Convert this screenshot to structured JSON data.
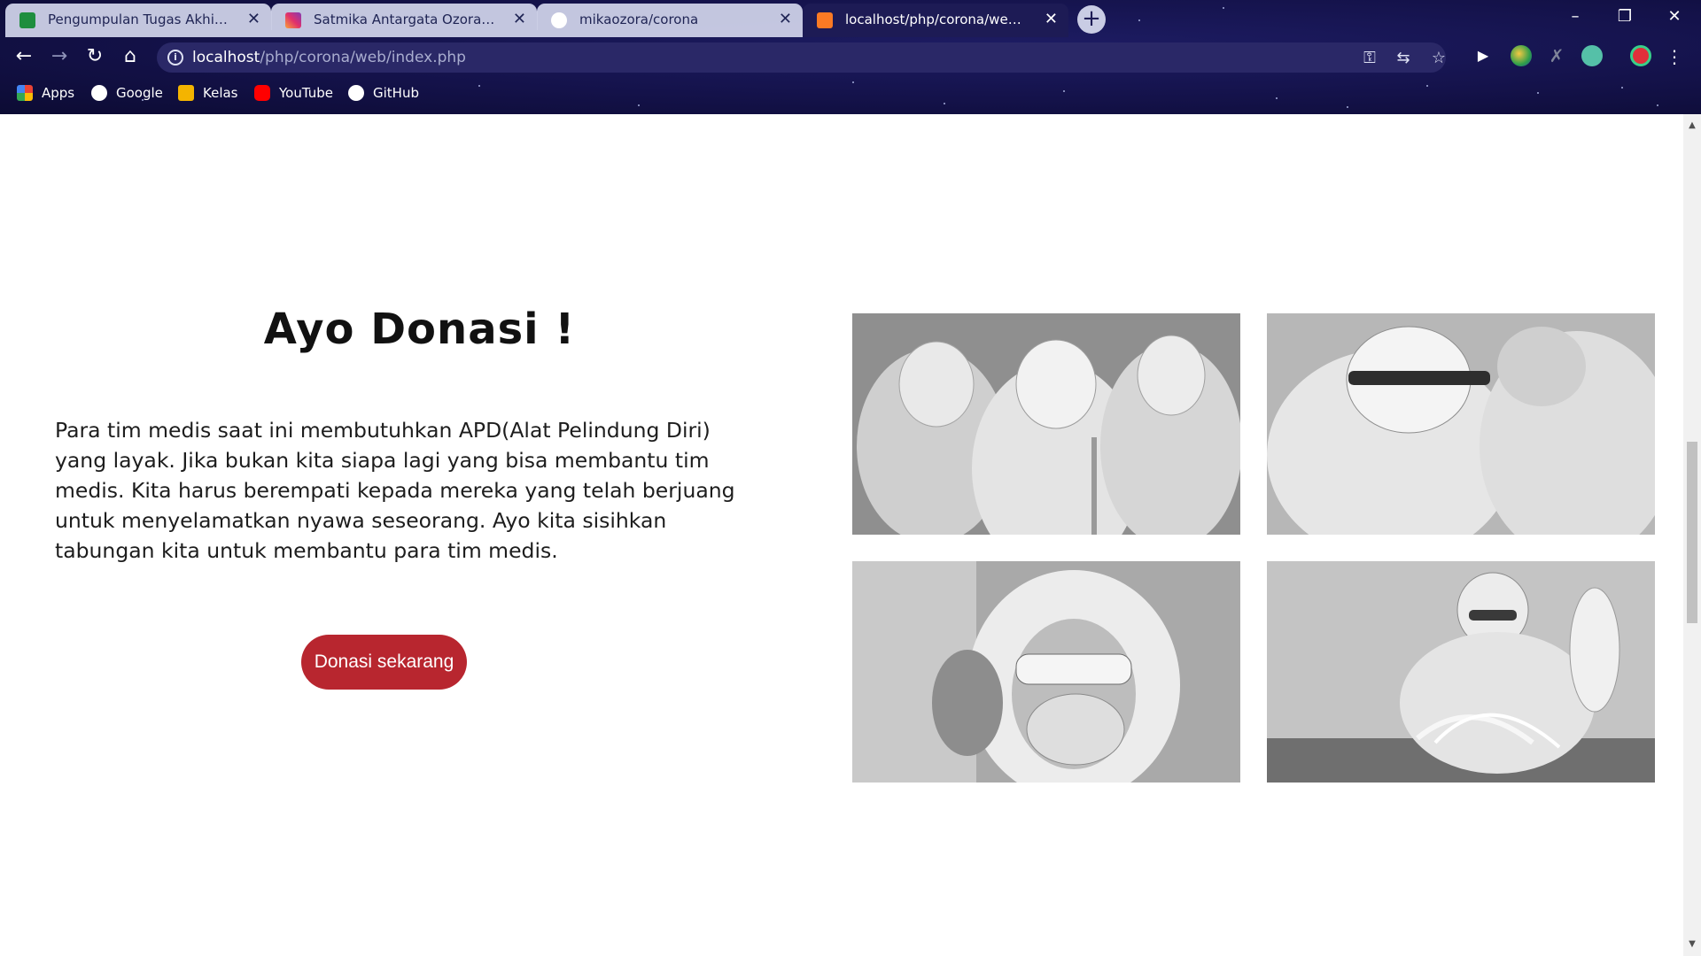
{
  "browser": {
    "tabs": [
      {
        "title": "Pengumpulan Tugas Akhir Web",
        "favicon_color": "#1e8e3e",
        "active": false
      },
      {
        "title": "Satmika Antargata Ozora (@antargata)",
        "favicon_color": "#e1306c",
        "active": false
      },
      {
        "title": "mikaozora/corona",
        "favicon_color": "#ffffff",
        "active": false
      },
      {
        "title": "localhost/php/corona/web/index.php",
        "favicon_color": "#fb7a24",
        "active": true
      }
    ],
    "new_tab_label": "+",
    "address": {
      "host": "localhost",
      "path": "/php/corona/web/index.php"
    },
    "bookmarks": [
      {
        "label": "Apps",
        "icon": "apps-grid-icon",
        "color": "#4285f4"
      },
      {
        "label": "Google",
        "icon": "google-icon",
        "color": "#ffffff"
      },
      {
        "label": "Kelas",
        "icon": "classroom-icon",
        "color": "#f4b400"
      },
      {
        "label": "YouTube",
        "icon": "youtube-icon",
        "color": "#ff0000"
      },
      {
        "label": "GitHub",
        "icon": "github-icon",
        "color": "#ffffff"
      }
    ]
  },
  "page": {
    "heading": "Ayo Donasi !",
    "body": "Para tim medis saat ini membutuhkan APD(Alat Pelindung Diri) yang layak. Jika bukan kita siapa lagi yang bisa membantu tim medis. Kita harus berempati kepada mereka yang telah berjuang untuk menyelamatkan nyawa seseorang. Ayo kita sisihkan tabungan kita untuk membantu para tim medis.",
    "cta_label": "Donasi sekarang",
    "accent_color": "#b8262f"
  }
}
